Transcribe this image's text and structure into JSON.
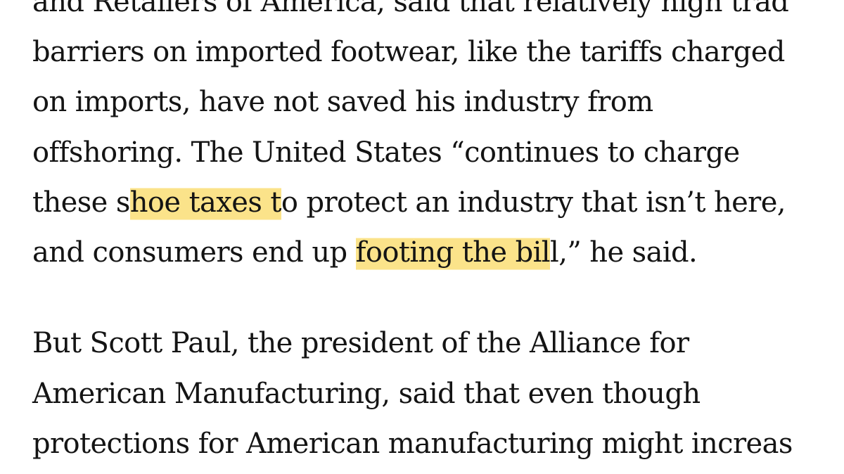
{
  "paragraph1": {
    "line1": "and Retailers of America, said that relatively high trad",
    "line2": "barriers on imported footwear, like the tariffs charged",
    "line3": "on imports, have not saved his industry from",
    "line4": "offshoring. The United States “continues to charge",
    "line5": {
      "prefix": "these s",
      "highlight": "hoe taxes",
      "highlight_tail": " t",
      "suffix": "o protect an industry that isn’t here,"
    },
    "line6": {
      "prefix": "and consumers end up ",
      "highlight": "footing the bil",
      "suffix": "l,” he said."
    }
  },
  "paragraph2": {
    "line1": "But Scott Paul, the president of the Alliance for",
    "line2": "American Manufacturing, said that even though",
    "line3": "protections for American manufacturing might increas"
  },
  "highlight_color": "#fbe38a",
  "text_color": "#141414"
}
